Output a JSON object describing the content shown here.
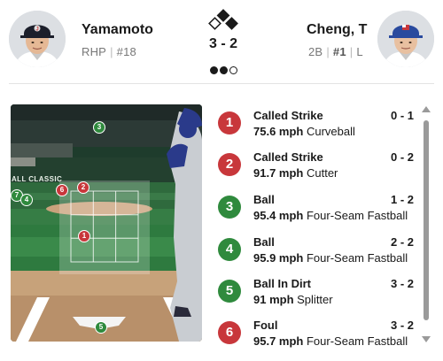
{
  "pitcher": {
    "name": "Yamamoto",
    "hand": "RHP",
    "number": "#18"
  },
  "batter": {
    "name": "Cheng, T",
    "position": "2B",
    "number": "#1",
    "bats": "L"
  },
  "game": {
    "count": "3 - 2",
    "outs": [
      true,
      true,
      false
    ],
    "bases_occupied": [
      false,
      true,
      true
    ]
  },
  "field": {
    "banner_text": "ALL CLASSIC"
  },
  "pitch_markers": [
    {
      "number": "3",
      "color": "green"
    },
    {
      "number": "6",
      "color": "red"
    },
    {
      "number": "2",
      "color": "red"
    },
    {
      "number": "7",
      "color": "green"
    },
    {
      "number": "4",
      "color": "green"
    },
    {
      "number": "1",
      "color": "red"
    },
    {
      "number": "5",
      "color": "green"
    }
  ],
  "pitches": [
    {
      "number": "1",
      "color": "red",
      "result": "Called Strike",
      "count": "0 - 1",
      "speed": "75.6 mph",
      "type": "Curveball"
    },
    {
      "number": "2",
      "color": "red",
      "result": "Called Strike",
      "count": "0 - 2",
      "speed": "91.7 mph",
      "type": "Cutter"
    },
    {
      "number": "3",
      "color": "green",
      "result": "Ball",
      "count": "1 - 2",
      "speed": "95.4 mph",
      "type": "Four-Seam Fastball"
    },
    {
      "number": "4",
      "color": "green",
      "result": "Ball",
      "count": "2 - 2",
      "speed": "95.9 mph",
      "type": "Four-Seam Fastball"
    },
    {
      "number": "5",
      "color": "green",
      "result": "Ball In Dirt",
      "count": "3 - 2",
      "speed": "91 mph",
      "type": "Splitter"
    },
    {
      "number": "6",
      "color": "red",
      "result": "Foul",
      "count": "3 - 2",
      "speed": "95.7 mph",
      "type": "Four-Seam Fastball"
    }
  ],
  "colors": {
    "strike": "#c8373b",
    "ball": "#2f8a3d",
    "scrollbar": "#9a9a9a"
  }
}
